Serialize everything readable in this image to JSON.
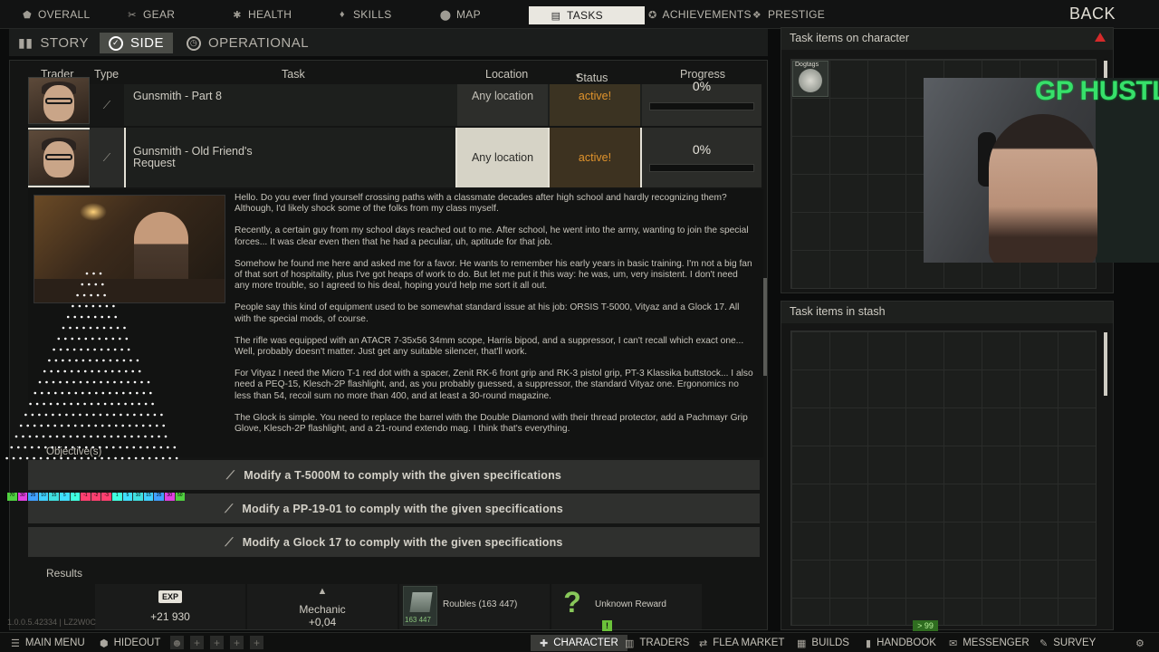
{
  "topnav": {
    "tabs": [
      {
        "label": "OVERALL",
        "icon": "gamepad-icon"
      },
      {
        "label": "GEAR",
        "icon": "gear-icon"
      },
      {
        "label": "HEALTH",
        "icon": "health-icon"
      },
      {
        "label": "SKILLS",
        "icon": "skills-icon"
      },
      {
        "label": "MAP",
        "icon": "map-pin-icon"
      },
      {
        "label": "TASKS",
        "icon": "tasks-icon",
        "active": true
      },
      {
        "label": "ACHIEVEMENTS",
        "icon": "achievements-icon"
      },
      {
        "label": "PRESTIGE",
        "icon": "prestige-icon"
      }
    ],
    "back_label": "BACK"
  },
  "subtabs": {
    "story": "STORY",
    "side": "SIDE",
    "operational": "OPERATIONAL"
  },
  "table": {
    "headers": {
      "trader": "Trader",
      "type": "Type",
      "task": "Task",
      "location": "Location",
      "status": "Status",
      "progress": "Progress"
    },
    "rows": [
      {
        "task": "Gunsmith - Part 8",
        "location": "Any location",
        "status": "active!",
        "progress": "0%"
      },
      {
        "task": "Gunsmith - Old Friend's Request",
        "location": "Any location",
        "status": "active!",
        "progress": "0%"
      }
    ]
  },
  "description": [
    "Hello. Do you ever find yourself crossing paths with a classmate decades after high school and hardly recognizing them? Although, I'd likely shock some of the folks from my class myself.",
    "Recently, a certain guy from my school days reached out to me. After school, he went into the army, wanting to join the special forces... It was clear even then that he had a peculiar, uh, aptitude for that job.",
    "Somehow he found me here and asked me for a favor. He wants to remember his early years in basic training. I'm not a big fan of that sort of hospitality, plus I've got heaps of work to do. But let me put it this way: he was, um, very insistent. I don't need any more trouble, so I agreed to his deal, hoping you'd help me sort it all out.",
    "People say this kind of equipment used to be somewhat standard issue at his job: ORSIS T-5000, Vityaz and a Glock 17. All with the special mods, of course.",
    "The rifle was equipped with an ATACR 7-35x56 34mm scope, Harris bipod, and a suppressor, I can't recall which exact one... Well, probably doesn't matter. Just get any suitable silencer, that'll work.",
    "For Vityaz I need the Micro T-1 red dot with a spacer, Zenit RK-6 front grip and RK-3 pistol grip, PT-3 Klassika buttstock... I also need a PEQ-15, Klesch-2P flashlight, and, as you probably guessed, a suppressor, the standard Vityaz one. Ergonomics no less than 54, recoil sum no more than 400, and at least a 30-round magazine.",
    "The Glock is simple. You need to replace the barrel with the Double Diamond with their thread protector, add a Pachmayr Grip Glove, Klesch-2P flashlight, and a 21-round extendo mag. I think that's everything."
  ],
  "objectives": {
    "label": "Objective(s)",
    "items": [
      "Modify a T-5000M to comply with the given specifications",
      "Modify a PP-19-01 to comply with the given specifications",
      "Modify a Glock 17 to comply with the given specifications"
    ]
  },
  "results": {
    "label": "Results",
    "exp_badge": "EXP",
    "exp_value": "+21 930",
    "rep_trader": "Mechanic",
    "rep_value": "+0,04",
    "money_count": "163 447",
    "money_label": "Roubles (163 447)",
    "unknown_icon": "?",
    "unknown_label": "Unknown Reward"
  },
  "right": {
    "char_title": "Task items on character",
    "stash_title": "Task items in stash",
    "dogtag_text": "Dogtags"
  },
  "overlay": {
    "cam_title": "GP HUSTLA",
    "color_strip": [
      "70",
      "30",
      "25",
      "10",
      "15",
      "5",
      "1",
      "-1",
      "-2",
      "-3",
      "1",
      "5",
      "10",
      "15",
      "25",
      "30",
      "50"
    ]
  },
  "version": "1.0.0.5.42334 | LZ2W0C",
  "level_badge": "> 99",
  "alert_badge": "!",
  "bottombar": {
    "main_menu": "MAIN MENU",
    "hideout": "HIDEOUT",
    "character": "CHARACTER",
    "traders": "TRADERS",
    "flea_market": "FLEA MARKET",
    "builds": "BUILDS",
    "handbook": "HANDBOOK",
    "messenger": "MESSENGER",
    "survey": "SURVEY"
  },
  "colors": {
    "status_active": "#e0932c",
    "accent_green": "#6bc23a",
    "warning_red": "#d62a2a"
  }
}
